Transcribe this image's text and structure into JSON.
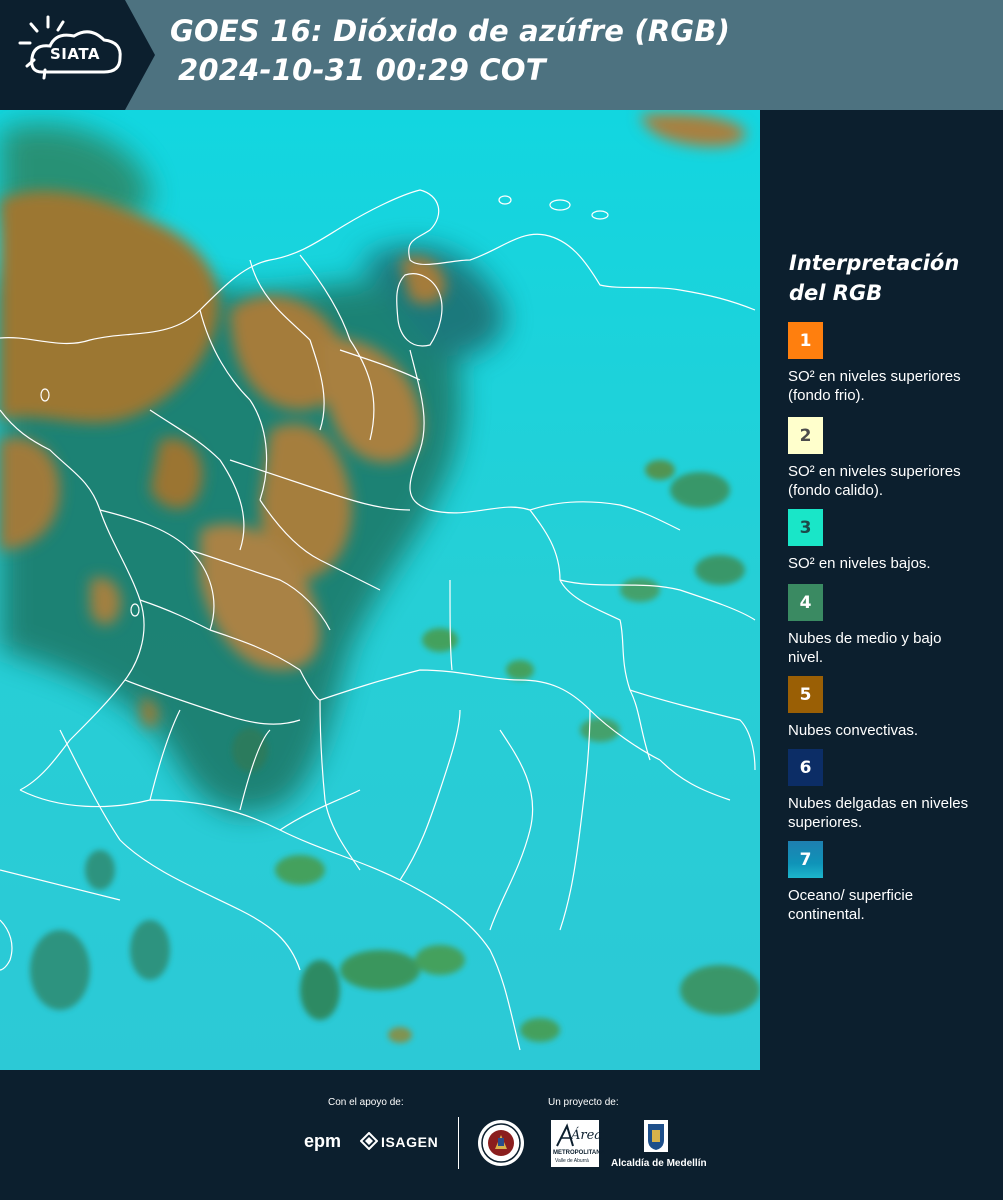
{
  "header": {
    "logo_text": "SIATA",
    "title_line1": "GOES 16: Dióxido de azúfre (RGB)",
    "title_line2": "2024-10-31 00:29 COT"
  },
  "legend": {
    "title_line1": "Interpretación",
    "title_line2": "del RGB",
    "items": [
      {
        "number": "1",
        "label": "SO² en niveles superiores (fondo frio).",
        "color": "#ff7f0e"
      },
      {
        "number": "2",
        "label": "SO² en niveles superiores (fondo calido).",
        "color": "#ffffcc"
      },
      {
        "number": "3",
        "label": "SO² en niveles bajos.",
        "color": "#19e6c8"
      },
      {
        "number": "4",
        "label": "Nubes de medio y bajo nivel.",
        "color": "#3a8a62"
      },
      {
        "number": "5",
        "label": "Nubes convectivas.",
        "color": "#9a5f05"
      },
      {
        "number": "6",
        "label": "Nubes delgadas en niveles superiores.",
        "color": "#0c2d66"
      },
      {
        "number": "7",
        "label": "Oceano/ superficie continental.",
        "color": "#1390b5"
      }
    ]
  },
  "footer": {
    "support_label": "Con el apoyo de:",
    "project_label": "Un proyecto de:",
    "partner_epm": "epm",
    "partner_isagen": "ISAGEN",
    "partner_area": "Área",
    "partner_area_sub": "METROPOLITANA",
    "partner_area_sub2": "Valle de Aburrá",
    "partner_alcaldia": "Alcaldía de Medellín"
  },
  "colors": {
    "header_bg": "#4d7280",
    "panel_bg": "#0c1f2e",
    "map_cyan": "#20cfd8",
    "cloud_brown": "#a07a3a",
    "cloud_green": "#1f7a55"
  }
}
